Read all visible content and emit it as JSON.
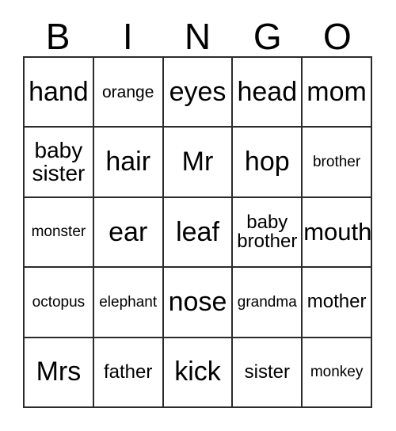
{
  "card": {
    "header_letters": [
      "B",
      "I",
      "N",
      "G",
      "O"
    ],
    "grid": {
      "columns": 5,
      "rows": 5,
      "border_color": "#2b2b2b",
      "background_color": "#ffffff",
      "text_color": "#000000"
    },
    "cells": [
      [
        {
          "text": "hand",
          "size": "fs-xl"
        },
        {
          "text": "orange",
          "size": "fs-xs"
        },
        {
          "text": "eyes",
          "size": "fs-xl"
        },
        {
          "text": "head",
          "size": "fs-xl"
        },
        {
          "text": "mom",
          "size": "fs-xl"
        }
      ],
      [
        {
          "text": "baby\nsister",
          "size": "fs-md"
        },
        {
          "text": "hair",
          "size": "fs-xl"
        },
        {
          "text": "Mr",
          "size": "fs-xl"
        },
        {
          "text": "hop",
          "size": "fs-xl"
        },
        {
          "text": "brother",
          "size": "fs-xxs"
        }
      ],
      [
        {
          "text": "monster",
          "size": "fs-xxs"
        },
        {
          "text": "ear",
          "size": "fs-xl"
        },
        {
          "text": "leaf",
          "size": "fs-xl"
        },
        {
          "text": "baby\nbrother",
          "size": "fs-sm"
        },
        {
          "text": "mouth",
          "size": "fs-lg"
        }
      ],
      [
        {
          "text": "octopus",
          "size": "fs-xxs"
        },
        {
          "text": "elephant",
          "size": "fs-xxs"
        },
        {
          "text": "nose",
          "size": "fs-xl"
        },
        {
          "text": "grandma",
          "size": "fs-xxs"
        },
        {
          "text": "mother",
          "size": "fs-sm"
        }
      ],
      [
        {
          "text": "Mrs",
          "size": "fs-xl"
        },
        {
          "text": "father",
          "size": "fs-sm"
        },
        {
          "text": "kick",
          "size": "fs-xl"
        },
        {
          "text": "sister",
          "size": "fs-sm"
        },
        {
          "text": "monkey",
          "size": "fs-xxs"
        }
      ]
    ]
  }
}
